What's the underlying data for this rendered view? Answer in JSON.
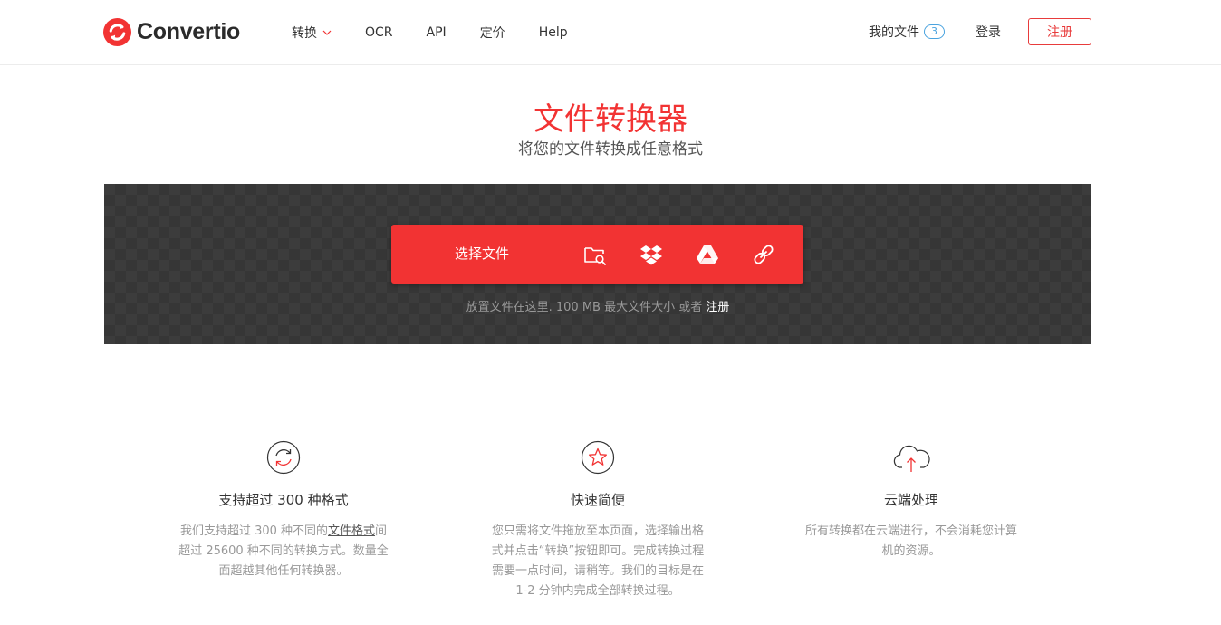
{
  "header": {
    "logo_text": "Convertio",
    "nav": [
      {
        "label": "转换",
        "has_dropdown": true
      },
      {
        "label": "OCR"
      },
      {
        "label": "API"
      },
      {
        "label": "定价"
      },
      {
        "label": "Help"
      }
    ],
    "my_files_label": "我的文件",
    "my_files_count": "3",
    "login_label": "登录",
    "signup_label": "注册"
  },
  "hero": {
    "title": "文件转换器",
    "subtitle": "将您的文件转换成任意格式"
  },
  "upload": {
    "choose_label": "选择文件",
    "sources": [
      "folder-search-icon",
      "dropbox-icon",
      "google-drive-icon",
      "url-link-icon"
    ],
    "drop_hint": "放置文件在这里. 100 MB 最大文件大小 或者",
    "drop_hint_link": "注册"
  },
  "features": [
    {
      "icon": "refresh-icon",
      "title": "支持超过 300 种格式",
      "desc_before": "我们支持超过 300 种不同的",
      "desc_link": "文件格式",
      "desc_after": "间超过 25600 种不同的转换方式。数量全面超越其他任何转换器。"
    },
    {
      "icon": "star-icon",
      "title": "快速简便",
      "desc": "您只需将文件拖放至本页面，选择输出格式并点击“转换”按钮即可。完成转换过程需要一点时间，请稍等。我们的目标是在 1-2 分钟内完成全部转换过程。"
    },
    {
      "icon": "cloud-upload-icon",
      "title": "云端处理",
      "desc": "所有转换都在云端进行，不会消耗您计算机的资源。"
    }
  ],
  "colors": {
    "brand_red": "#f23333",
    "badge_blue": "#4aa3df"
  }
}
